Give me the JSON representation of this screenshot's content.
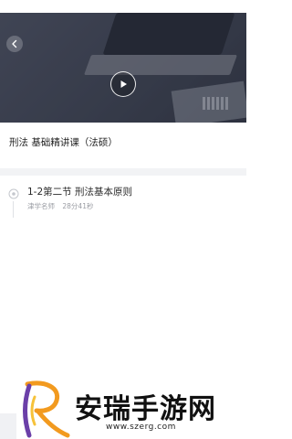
{
  "video": {
    "back_icon": "chevron-left-icon",
    "play_icon": "play-icon"
  },
  "course": {
    "title": "刑法 基础精讲课（法硕）"
  },
  "lessons": [
    {
      "title": "1-2第二节 刑法基本原则",
      "teacher": "津学名师",
      "duration": "28分41秒",
      "icon": "eye-icon"
    }
  ],
  "watermark": {
    "name": "安瑞手游网",
    "url": "www.szerg.com",
    "logo": "stylized-R-logo"
  },
  "colors": {
    "title": "#222222",
    "meta": "#9a9ca3",
    "divider": "#f2f3f5",
    "logo_orange": "#f29a1f",
    "logo_purple": "#6b3fa8"
  }
}
